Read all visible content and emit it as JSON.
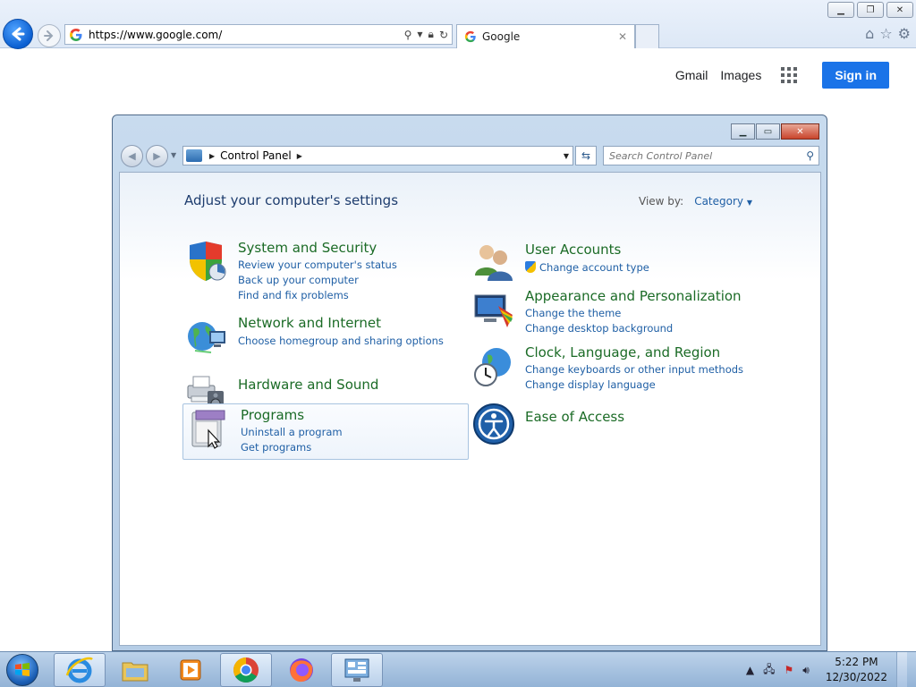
{
  "browser": {
    "url": "https://www.google.com/",
    "tab_title": "Google",
    "tab_close": "✕"
  },
  "google": {
    "gmail": "Gmail",
    "images": "Images",
    "signin": "Sign in"
  },
  "control_panel": {
    "breadcrumb": "Control Panel",
    "search_placeholder": "Search Control Panel",
    "heading": "Adjust your computer's settings",
    "view_by_label": "View by:",
    "view_by_value": "Category",
    "left_categories": [
      {
        "title": "System and Security",
        "links": [
          "Review your computer's status",
          "Back up your computer",
          "Find and fix problems"
        ]
      },
      {
        "title": "Network and Internet",
        "links": [
          "Choose homegroup and sharing options"
        ]
      },
      {
        "title": "Hardware and Sound",
        "links": []
      },
      {
        "title": "Programs",
        "links": [
          "Uninstall a program",
          "Get programs"
        ]
      }
    ],
    "right_categories": [
      {
        "title": "User Accounts",
        "links": [
          "Change account type"
        ]
      },
      {
        "title": "Appearance and Personalization",
        "links": [
          "Change the theme",
          "Change desktop background"
        ]
      },
      {
        "title": "Clock, Language, and Region",
        "links": [
          "Change keyboards or other input methods",
          "Change display language"
        ]
      },
      {
        "title": "Ease of Access",
        "links": []
      }
    ]
  },
  "taskbar": {
    "time": "5:22 PM",
    "date": "12/30/2022"
  }
}
